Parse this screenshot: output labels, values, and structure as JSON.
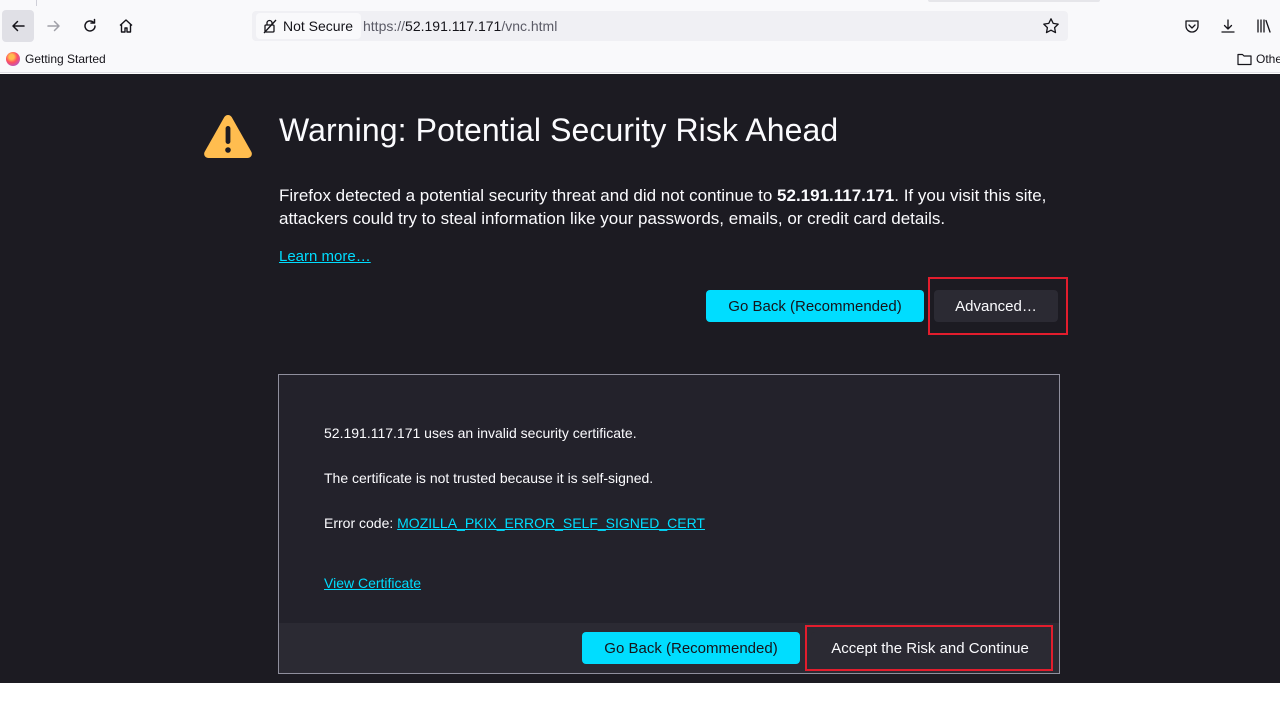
{
  "browser": {
    "nav": {
      "back": "back-arrow-icon",
      "forward": "forward-arrow-icon",
      "reload": "reload-icon",
      "home": "home-icon"
    },
    "urlbar": {
      "security_label": "Not Secure",
      "url_prefix": "https://",
      "url_host": "52.191.117.171",
      "url_path": "/vnc.html"
    },
    "bookmarks": {
      "getting_started": "Getting Started",
      "other": "Othe"
    }
  },
  "page": {
    "title": "Warning: Potential Security Risk Ahead",
    "description_before": "Firefox detected a potential security threat and did not continue to ",
    "description_host": "52.191.117.171",
    "description_after": ". If you visit this site, attackers could try to steal information like your passwords, emails, or credit card details.",
    "learn_more": "Learn more…",
    "go_back_label": "Go Back (Recommended)",
    "advanced_label": "Advanced…",
    "advanced_panel": {
      "line1": "52.191.117.171 uses an invalid security certificate.",
      "line2": "The certificate is not trusted because it is self-signed.",
      "error_prefix": "Error code: ",
      "error_code": "MOZILLA_PKIX_ERROR_SELF_SIGNED_CERT",
      "view_certificate": "View Certificate",
      "go_back_label": "Go Back (Recommended)",
      "accept_label": "Accept the Risk and Continue"
    }
  },
  "colors": {
    "page_bg": "#1c1b22",
    "accent": "#00ddff",
    "warning": "#ffbd4f",
    "highlight": "#e21d2d"
  }
}
